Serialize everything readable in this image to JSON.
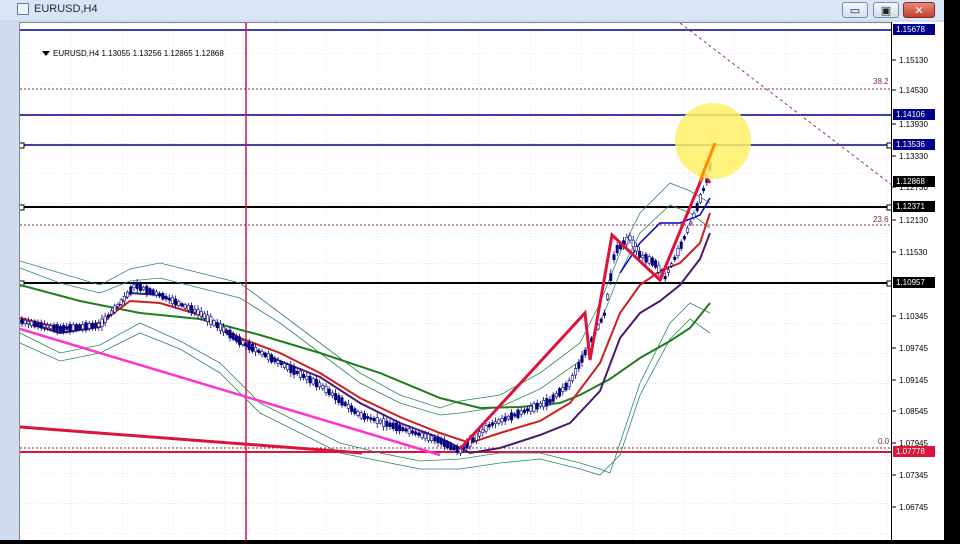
{
  "window": {
    "title": "EURUSD,H4",
    "buttons": {
      "minimize": "▭",
      "maximize": "▣",
      "close": "✕"
    }
  },
  "chart": {
    "symbol_info": "EURUSD,H4  1.13055 1.13256 1.12865 1.12868",
    "fib_labels": {
      "f382": "38.2",
      "f236": "23.6",
      "f00": "0.0"
    },
    "colors": {
      "horizontal_lines": "#00008b",
      "black_lines": "#000000",
      "red_line": "#dc143c",
      "magenta_trend": "#ff33cc",
      "ma_green": "#1e7d1e",
      "ma_purple": "#4b1a6e",
      "ma_red": "#cc1f1f",
      "bollinger": "#2e8b57",
      "highlight_circle": "#fff066"
    }
  },
  "price_axis": {
    "ticks": [
      "1.15130",
      "1.14530",
      "1.13930",
      "1.13330",
      "1.12730",
      "1.12130",
      "1.11530",
      "1.10345",
      "1.09745",
      "1.09145",
      "1.08545",
      "1.07945",
      "1.07345",
      "1.06745"
    ],
    "line_labels": [
      {
        "name": "1.15678",
        "color": "#00008b",
        "text_color": "#ffffff"
      },
      {
        "name": "1.14106",
        "color": "#00008b",
        "text_color": "#ffffff"
      },
      {
        "name": "1.13536",
        "color": "#00008b",
        "text_color": "#ffffff"
      },
      {
        "name": "1.12868",
        "color": "#000000",
        "text_color": "#ffffff"
      },
      {
        "name": "1.12371",
        "color": "#000000",
        "text_color": "#ffffff"
      },
      {
        "name": "1.10957",
        "color": "#000000",
        "text_color": "#ffffff"
      },
      {
        "name": "1.07778",
        "color": "#dc143c",
        "text_color": "#ffffff"
      }
    ]
  }
}
